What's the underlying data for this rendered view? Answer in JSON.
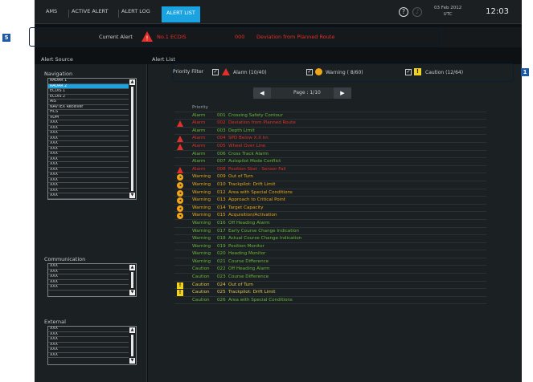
{
  "tabs": [
    {
      "label": "AMS",
      "active": false
    },
    {
      "label": "ACTIVE ALERT",
      "active": false
    },
    {
      "label": "ALERT LOG",
      "active": false
    },
    {
      "label": "ALERT LIST",
      "active": true
    }
  ],
  "status": {
    "date_line1": "03 Feb 2012",
    "date_line2": "UTC",
    "time": "12:03"
  },
  "current_alert": {
    "label": "Current Alert",
    "name": "No.1 ECDIS",
    "code": "000",
    "description": "Deviation from Planned Route",
    "color": "#e0302c"
  },
  "alert_source": {
    "title": "Alert Source",
    "groups": [
      {
        "label": "Navigation",
        "items": [
          "RADAR 1",
          "RADAR 2",
          "ECDIS 1",
          "ECDIS 2",
          "AIS",
          "NAVTEX Receiver",
          "HCS",
          "VDM",
          "XXX",
          "XXX",
          "XXX",
          "XXX",
          "XXX",
          "XXX",
          "XXX",
          "XXX",
          "XXX",
          "XXX",
          "XXX",
          "XXX",
          "XXX",
          "XXX",
          "XXX"
        ],
        "selected": 1
      },
      {
        "label": "Communication",
        "items": [
          "XXX",
          "XXX",
          "XXX",
          "XXX",
          "XXX"
        ],
        "selected": -1
      },
      {
        "label": "External",
        "items": [
          "XXX",
          "XXX",
          "XXX",
          "XXX",
          "XXX",
          "XXX"
        ],
        "selected": -1
      }
    ]
  },
  "alert_list": {
    "title": "Alert List",
    "filter": {
      "label": "Priority Filter",
      "alarm": "Alarm (10/40)",
      "warning": "Warning ( 8/60)",
      "caution": "Caution (12/64)"
    },
    "page_label": "Page : 1/10",
    "header": "Priority",
    "rows": [
      {
        "icon": "",
        "priority": "Alarm",
        "code": "001",
        "desc": "Crossing Safety Contour",
        "style": "caution"
      },
      {
        "icon": "alarm",
        "priority": "Alarm",
        "code": "002",
        "desc": "Deviation from Planned Route",
        "style": "alarm"
      },
      {
        "icon": "",
        "priority": "Alarm",
        "code": "003",
        "desc": "Depth Limit",
        "style": "caution"
      },
      {
        "icon": "alarm",
        "priority": "Alarm",
        "code": "004",
        "desc": "SPD Below X.X kn",
        "style": "alarm"
      },
      {
        "icon": "alarm",
        "priority": "Alarm",
        "code": "005",
        "desc": "Wheel Over Line",
        "style": "alarm"
      },
      {
        "icon": "",
        "priority": "Alarm",
        "code": "006",
        "desc": "Cross Track Alarm",
        "style": "caution"
      },
      {
        "icon": "",
        "priority": "Alarm",
        "code": "007",
        "desc": "Autopilot Mode Conflict",
        "style": "caution"
      },
      {
        "icon": "alarm",
        "priority": "Alarm",
        "code": "008",
        "desc": "Position Sbst - Sensor Fail",
        "style": "alarm"
      },
      {
        "icon": "warning",
        "priority": "Warning",
        "code": "009",
        "desc": "Out of Turn",
        "style": "warning"
      },
      {
        "icon": "warning",
        "priority": "Warning",
        "code": "010",
        "desc": "Trackpilot: Drift Limit",
        "style": "warning"
      },
      {
        "icon": "warning",
        "priority": "Warning",
        "code": "012",
        "desc": "Area with Special Conditions",
        "style": "warning"
      },
      {
        "icon": "warning",
        "priority": "Warning",
        "code": "013",
        "desc": "Approach to Critical Point",
        "style": "warning"
      },
      {
        "icon": "warning",
        "priority": "Warning",
        "code": "014",
        "desc": "Target Capacity",
        "style": "warning"
      },
      {
        "icon": "warning",
        "priority": "Warning",
        "code": "015",
        "desc": "Acquisition/Activation",
        "style": "warning"
      },
      {
        "icon": "",
        "priority": "Warning",
        "code": "016",
        "desc": "Off Heading Alarm",
        "style": "caution"
      },
      {
        "icon": "",
        "priority": "Warning",
        "code": "017",
        "desc": "Early Course Change Indication",
        "style": "caution"
      },
      {
        "icon": "",
        "priority": "Warning",
        "code": "018",
        "desc": "Actual Course Change Indication",
        "style": "caution"
      },
      {
        "icon": "",
        "priority": "Warning",
        "code": "019",
        "desc": "Position Monitor",
        "style": "caution"
      },
      {
        "icon": "",
        "priority": "Warning",
        "code": "020",
        "desc": "Heading Monitor",
        "style": "caution"
      },
      {
        "icon": "",
        "priority": "Warning",
        "code": "021",
        "desc": "Course Difference",
        "style": "caution"
      },
      {
        "icon": "",
        "priority": "Caution",
        "code": "022",
        "desc": "Off Heading Alarm",
        "style": "caution"
      },
      {
        "icon": "",
        "priority": "Caution",
        "code": "023",
        "desc": "Course Difference",
        "style": "caution"
      },
      {
        "icon": "caution",
        "priority": "Caution",
        "code": "024",
        "desc": "Out of Turn",
        "style": "cautionY"
      },
      {
        "icon": "caution",
        "priority": "Caution",
        "code": "025",
        "desc": "Trackpilot: Drift Limit",
        "style": "cautionY"
      },
      {
        "icon": "",
        "priority": "Caution",
        "code": "026",
        "desc": "Area with Special Conditions",
        "style": "caution"
      }
    ]
  },
  "callouts": [
    {
      "number": "5"
    },
    {
      "number": "1"
    }
  ]
}
